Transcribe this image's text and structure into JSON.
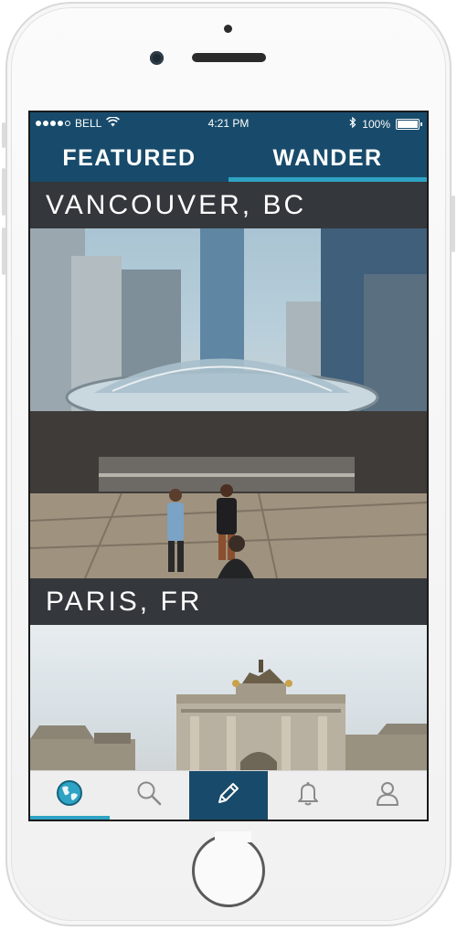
{
  "status_bar": {
    "carrier": "BELL",
    "time": "4:21 PM",
    "battery": "100%",
    "battery_level": 1.0,
    "signal_bars": 4
  },
  "tabs": [
    {
      "label": "FEATURED",
      "active": false
    },
    {
      "label": "WANDER",
      "active": true
    }
  ],
  "feed": [
    {
      "title": "VANCOUVER, BC"
    },
    {
      "title": "PARIS, FR"
    }
  ],
  "bottom_nav": [
    {
      "icon": "globe-icon",
      "selected": true
    },
    {
      "icon": "search-icon",
      "selected": false
    },
    {
      "icon": "pencil-icon",
      "selected": false
    },
    {
      "icon": "bell-icon",
      "selected": false
    },
    {
      "icon": "user-icon",
      "selected": false
    }
  ],
  "colors": {
    "brand": "#184b6b",
    "accent": "#2ea3c3",
    "caption_bg": "#373a3e",
    "nav_bg": "#eeeeee",
    "nav_icon": "#8a8a8a"
  }
}
